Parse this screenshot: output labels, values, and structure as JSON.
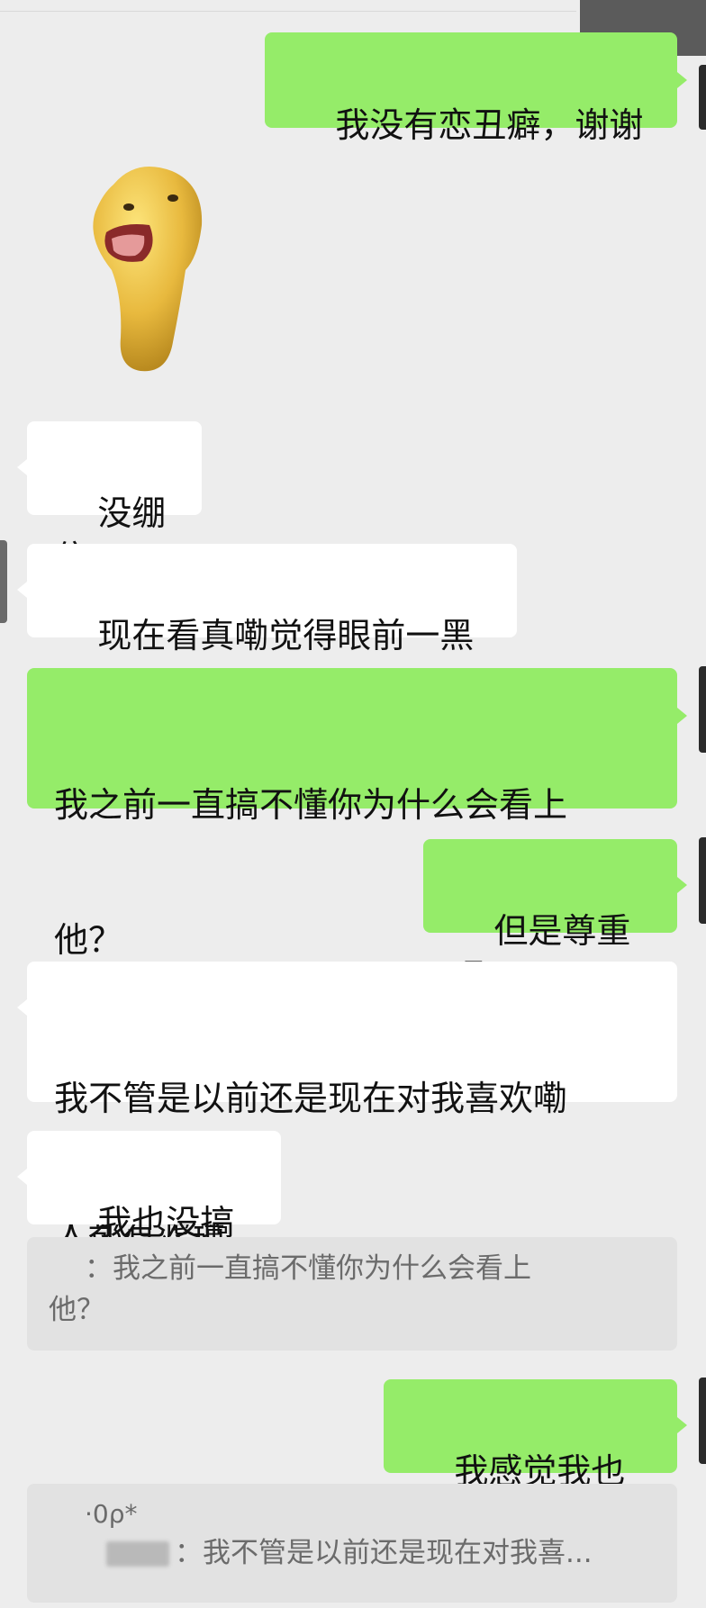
{
  "messages": [
    {
      "id": "m1",
      "side": "sent",
      "text": "我没有恋丑癖，谢谢"
    },
    {
      "id": "m2",
      "side": "recv",
      "type": "sticker",
      "sticker": "yellow-blob-sticker"
    },
    {
      "id": "m3",
      "side": "recv",
      "text": "没绷住"
    },
    {
      "id": "m4",
      "side": "recv",
      "text": "现在看真嘞觉得眼前一黑"
    },
    {
      "id": "m5",
      "side": "sent",
      "line1": "我之前一直搞不懂你为什么会看上",
      "line2": "他？"
    },
    {
      "id": "m6",
      "side": "sent",
      "text": "但是尊重吧"
    },
    {
      "id": "m7",
      "side": "recv",
      "line1": "我不管是以前还是现在对我喜欢嘞",
      "line2": "人都有滤镜"
    },
    {
      "id": "m8",
      "side": "recv",
      "text": "我也没搞懂"
    },
    {
      "id": "q1",
      "type": "quote",
      "line1": "：我之前一直搞不懂你为什么会看上",
      "line2": "他？"
    },
    {
      "id": "m9",
      "side": "sent",
      "text": "我感觉我也是"
    },
    {
      "id": "q2",
      "type": "quote",
      "line1": "·0ρ*",
      "line2": "：我不管是以前还是现在对我喜..."
    }
  ],
  "colors": {
    "background": "#ededed",
    "sent_bubble": "#95ec69",
    "received_bubble": "#ffffff",
    "quote_bubble": "#e2e2e2",
    "quote_text": "#6b6b6b"
  }
}
